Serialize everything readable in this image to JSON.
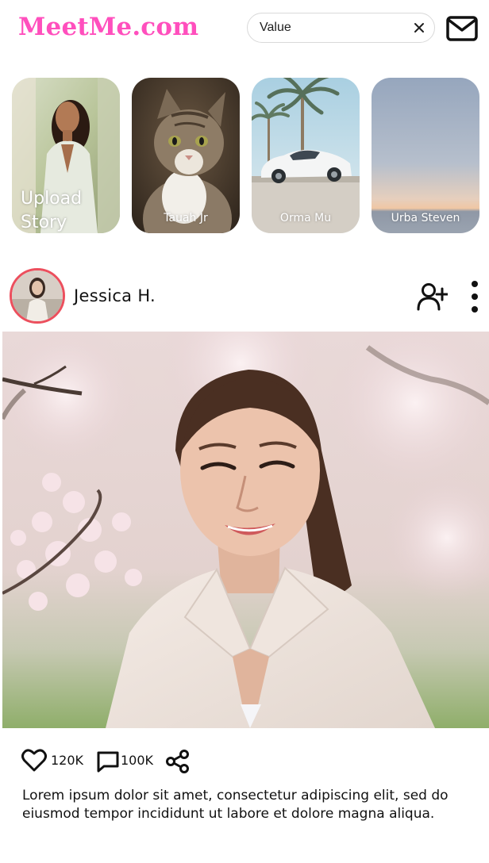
{
  "header": {
    "logo_text": "MeetMe.com",
    "search": {
      "value": "Value",
      "placeholder": "Value"
    },
    "mail_icon": "mail-icon",
    "clear_icon": "close-icon"
  },
  "stories": [
    {
      "label": "Upload Story",
      "kind": "upload"
    },
    {
      "label": "Tauah Jr"
    },
    {
      "label": "Orma Mu"
    },
    {
      "label": "Urba Steven"
    }
  ],
  "post": {
    "author": "Jessica H.",
    "follow_icon": "user-plus-icon",
    "more_icon": "more-vertical-icon",
    "likes": "120K",
    "comments": "100K",
    "share_icon": "share-icon",
    "caption": "Lorem ipsum dolor sit amet, consectetur adipiscing elit, sed do eiusmod  tempor incididunt ut labore et dolore magna aliqua."
  },
  "colors": {
    "brand": "#ff4fbd",
    "avatar_ring": "#ec4f5d",
    "text": "#111111"
  }
}
